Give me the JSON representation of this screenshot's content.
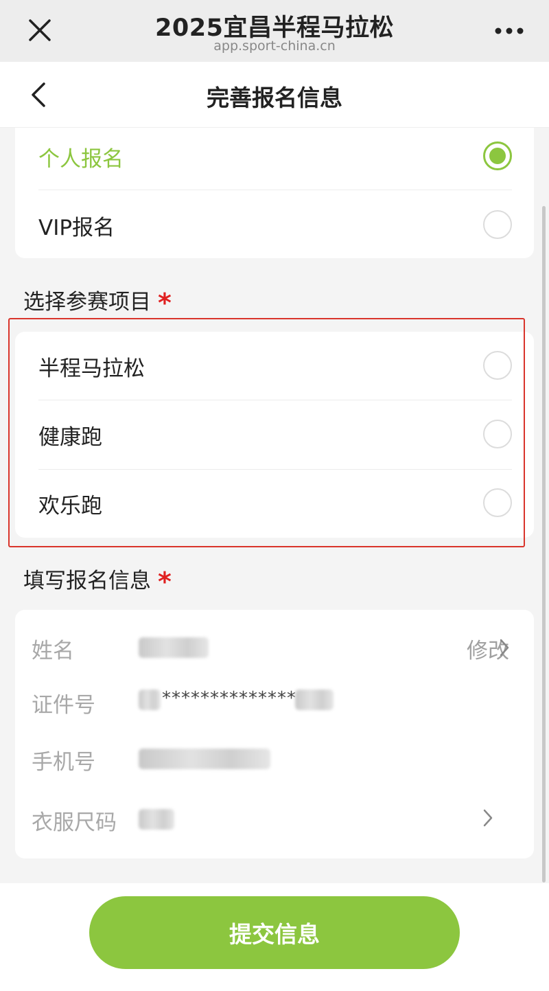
{
  "browser": {
    "title": "2025宜昌半程马拉松",
    "url": "app.sport-china.cn"
  },
  "nav": {
    "title": "完善报名信息"
  },
  "registration_type": {
    "options": [
      {
        "label": "个人报名",
        "selected": true
      },
      {
        "label": "VIP报名",
        "selected": false
      }
    ]
  },
  "events": {
    "title": "选择参赛项目",
    "required_mark": "*",
    "options": [
      {
        "label": "半程马拉松",
        "selected": false
      },
      {
        "label": "健康跑",
        "selected": false
      },
      {
        "label": "欢乐跑",
        "selected": false
      }
    ]
  },
  "info": {
    "title": "填写报名信息",
    "required_mark": "*",
    "name_label": "姓名",
    "modify_label": "修改",
    "id_label": "证件号",
    "id_value_masked": "**************",
    "phone_label": "手机号",
    "size_label": "衣服尺码"
  },
  "submit": {
    "label": "提交信息"
  },
  "colors": {
    "accent": "#8cc63f",
    "required": "#e02020",
    "highlight": "#d9342b"
  }
}
